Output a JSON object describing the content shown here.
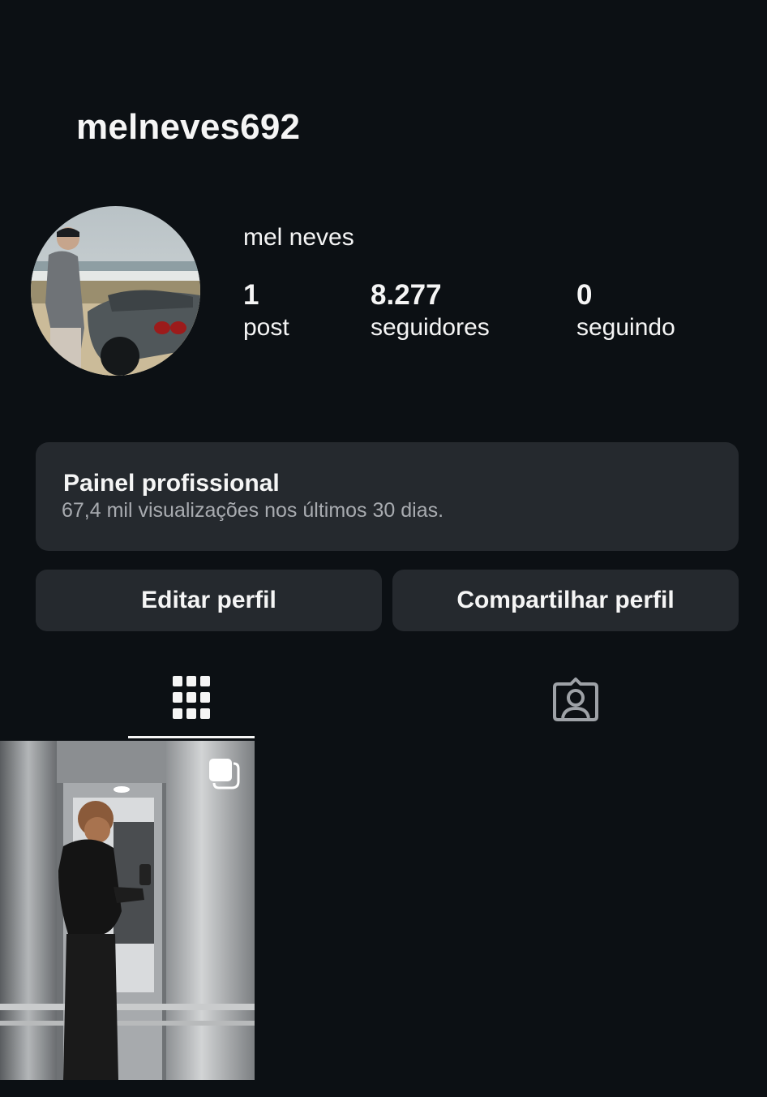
{
  "profile": {
    "username": "melneves692",
    "display_name": "mel neves",
    "avatar_icon": "profile-photo",
    "stats": {
      "posts": {
        "count": "1",
        "label": "post"
      },
      "followers": {
        "count": "8.277",
        "label": "seguidores"
      },
      "following": {
        "count": "0",
        "label": "seguindo"
      }
    }
  },
  "dashboard": {
    "title": "Painel profissional",
    "subtitle": "67,4 mil visualizações nos últimos 30 dias."
  },
  "actions": {
    "edit_label": "Editar perfil",
    "share_label": "Compartilhar perfil"
  },
  "tabs": [
    {
      "icon": "grid-icon",
      "active": true
    },
    {
      "icon": "tagged-person-icon",
      "active": false
    }
  ],
  "posts": [
    {
      "icon": "carousel-icon",
      "thumbnail": "elevator-mirror-selfie"
    }
  ],
  "colors": {
    "background": "#0c1014",
    "card": "#25292e",
    "text": "#f5f5f5",
    "muted": "#a8abb0"
  }
}
